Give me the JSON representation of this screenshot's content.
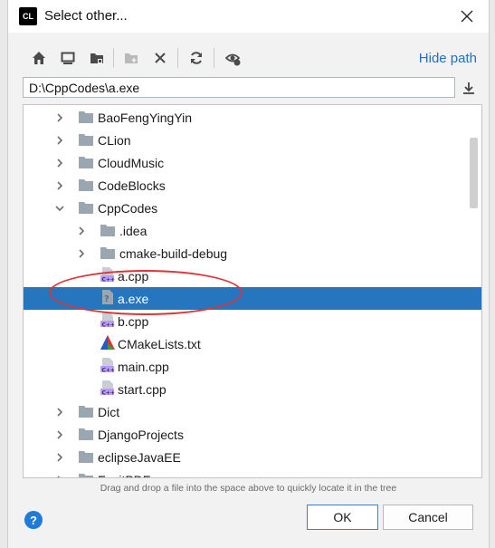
{
  "window": {
    "title": "Select other..."
  },
  "toolbar": {
    "hide_path_label": "Hide path",
    "icons": [
      "home-icon",
      "desktop-icon",
      "project-folder-icon",
      "new-folder-icon",
      "delete-icon",
      "refresh-icon",
      "show-hidden-icon"
    ]
  },
  "path": {
    "value": "D:\\CppCodes\\a.exe"
  },
  "tree": {
    "items": [
      {
        "label": "BaoFengYingYin",
        "kind": "folder",
        "depth": 0,
        "expanded": false
      },
      {
        "label": "CLion",
        "kind": "folder",
        "depth": 0,
        "expanded": false
      },
      {
        "label": "CloudMusic",
        "kind": "folder",
        "depth": 0,
        "expanded": false
      },
      {
        "label": "CodeBlocks",
        "kind": "folder",
        "depth": 0,
        "expanded": false
      },
      {
        "label": "CppCodes",
        "kind": "folder",
        "depth": 0,
        "expanded": true
      },
      {
        "label": ".idea",
        "kind": "folder",
        "depth": 1,
        "expanded": false
      },
      {
        "label": "cmake-build-debug",
        "kind": "folder",
        "depth": 1,
        "expanded": false
      },
      {
        "label": "a.cpp",
        "kind": "cpp",
        "depth": 1
      },
      {
        "label": "a.exe",
        "kind": "exe",
        "depth": 1,
        "selected": true
      },
      {
        "label": "b.cpp",
        "kind": "cpp",
        "depth": 1
      },
      {
        "label": "CMakeLists.txt",
        "kind": "cmake",
        "depth": 1
      },
      {
        "label": "main.cpp",
        "kind": "cpp",
        "depth": 1
      },
      {
        "label": "start.cpp",
        "kind": "cpp",
        "depth": 1
      },
      {
        "label": "Dict",
        "kind": "folder",
        "depth": 0,
        "expanded": false
      },
      {
        "label": "DjangoProjects",
        "kind": "folder",
        "depth": 0,
        "expanded": false
      },
      {
        "label": "eclipseJavaEE",
        "kind": "folder",
        "depth": 0,
        "expanded": false
      },
      {
        "label": "FoxitPDF",
        "kind": "folder",
        "depth": 0,
        "expanded": false
      }
    ]
  },
  "hint": "Drag and drop a file into the space above to quickly locate it in the tree",
  "buttons": {
    "ok": "OK",
    "cancel": "Cancel",
    "help": "?"
  },
  "colors": {
    "selection": "#2675bf",
    "link": "#2470c4",
    "annotation": "#d8363a"
  }
}
